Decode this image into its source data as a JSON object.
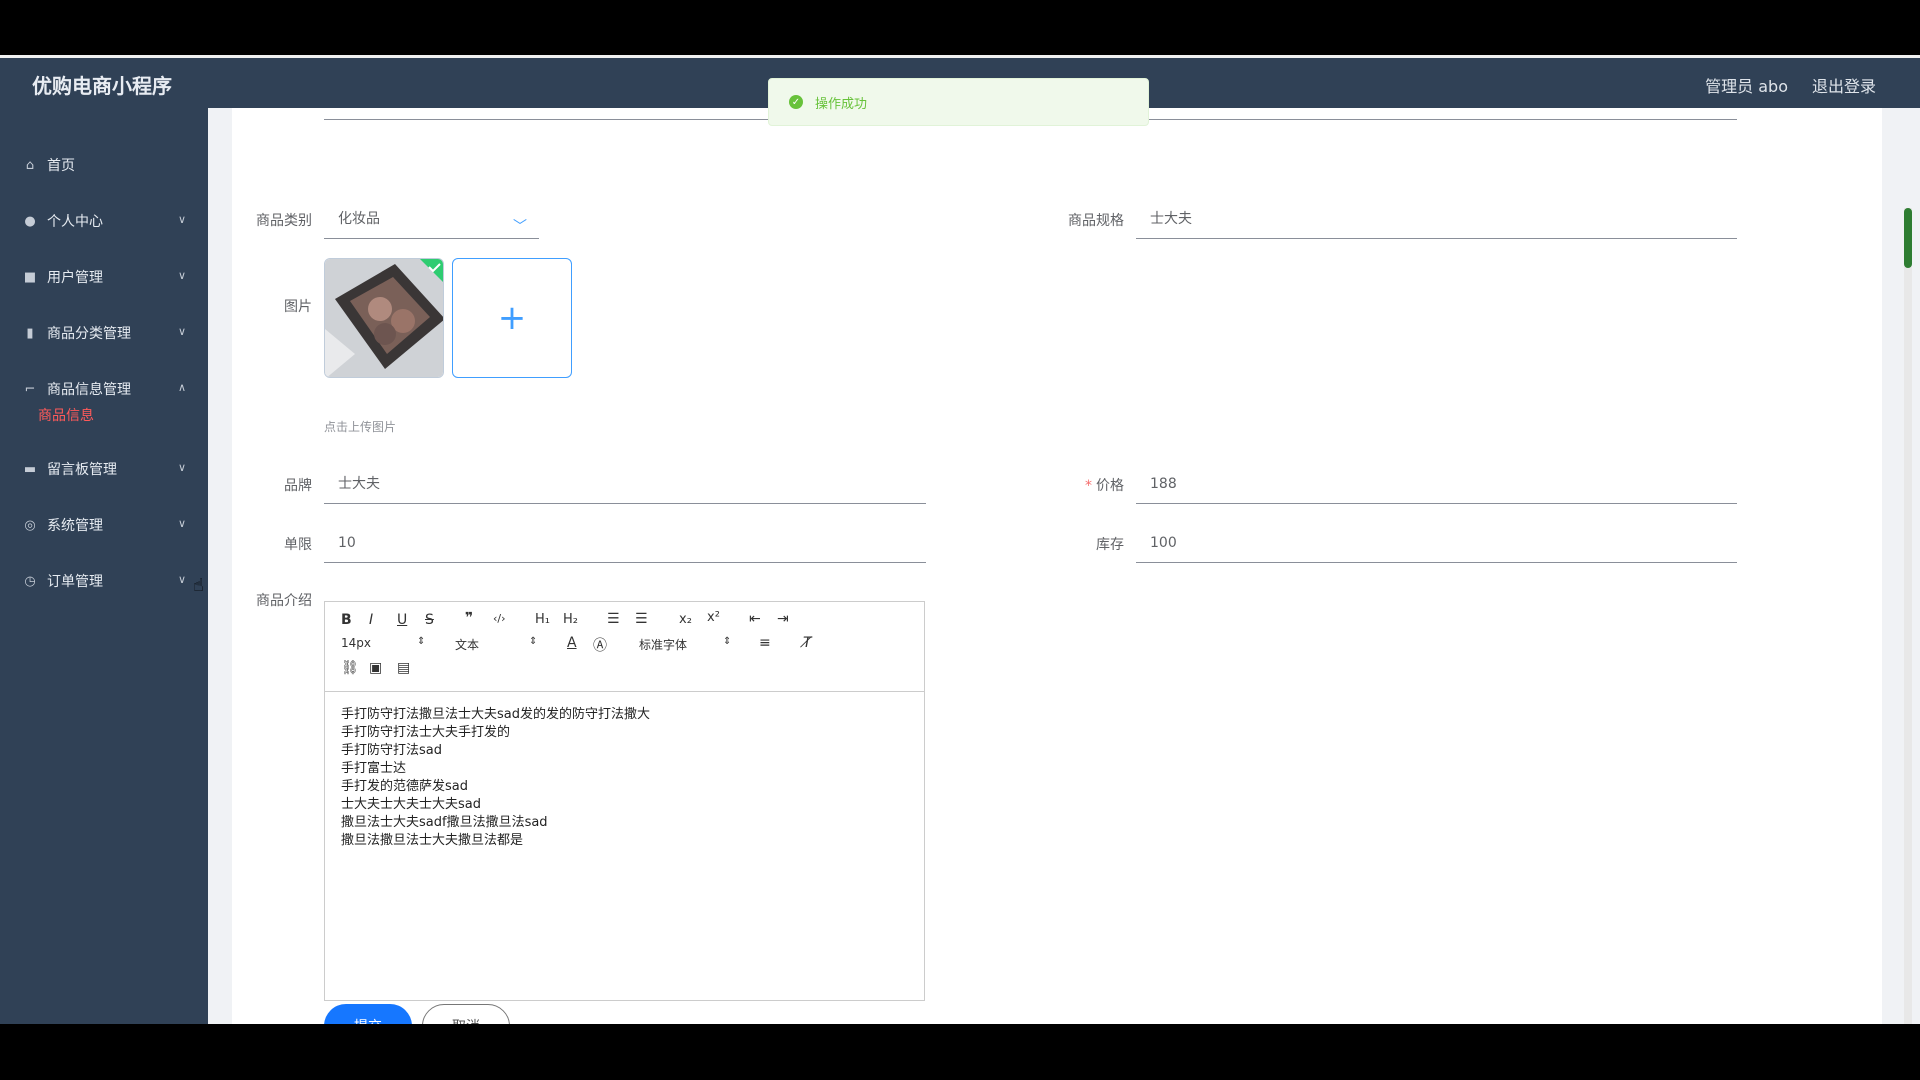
{
  "header": {
    "brand": "优购电商小程序",
    "admin": "管理员 abo",
    "logout": "退出登录"
  },
  "toast": {
    "message": "操作成功"
  },
  "sidebar": {
    "items": [
      {
        "label": "首页",
        "icon": "home-icon"
      },
      {
        "label": "个人中心",
        "icon": "user-icon"
      },
      {
        "label": "用户管理",
        "icon": "users-icon"
      },
      {
        "label": "商品分类管理",
        "icon": "chart-icon"
      },
      {
        "label": "商品信息管理",
        "icon": "crop-icon"
      },
      {
        "label": "留言板管理",
        "icon": "message-icon"
      },
      {
        "label": "系统管理",
        "icon": "settings-icon"
      },
      {
        "label": "订单管理",
        "icon": "order-icon"
      }
    ],
    "active_sub": "商品信息"
  },
  "form": {
    "category_label": "商品类别",
    "category_value": "化妆品",
    "spec_label": "商品规格",
    "spec_value": "士大夫",
    "image_label": "图片",
    "upload_hint": "点击上传图片",
    "brand_label": "品牌",
    "brand_value": "士大夫",
    "price_label": "价格",
    "price_value": "188",
    "limit_label": "单限",
    "limit_value": "10",
    "stock_label": "库存",
    "stock_value": "100",
    "intro_label": "商品介绍",
    "toolbar": {
      "font_size": "14px",
      "text_type": "文本",
      "font_family": "标准字体"
    },
    "intro_lines": [
      "手打防守打法撒旦法士大夫sad发的发的防守打法撒大",
      "手打防守打法士大夫手打发的",
      "手打防守打法sad",
      "手打富士达",
      "手打发的范德萨发sad",
      "士大夫士大夫士大夫sad",
      "撒旦法士大夫sadf撒旦法撒旦法sad",
      "撒旦法撒旦法士大夫撒旦法都是"
    ],
    "submit": "提交",
    "cancel": "取消"
  }
}
